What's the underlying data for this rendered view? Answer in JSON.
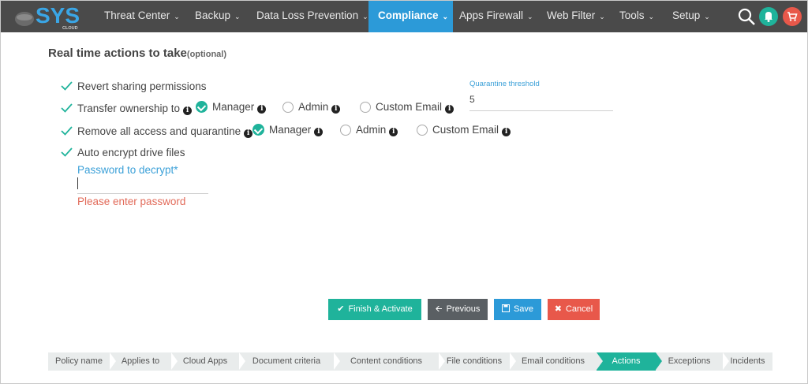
{
  "brand": {
    "logo_text": "SYS",
    "logo_sub": "CLOUD"
  },
  "nav": {
    "items": [
      {
        "label": "Threat Center"
      },
      {
        "label": "Backup"
      },
      {
        "label": "Data Loss Prevention"
      },
      {
        "label": "Compliance",
        "active": true
      },
      {
        "label": "Apps Firewall"
      },
      {
        "label": "Web Filter"
      },
      {
        "label": "Tools"
      },
      {
        "label": "Setup"
      }
    ],
    "icons": [
      "search-icon",
      "bell-icon",
      "cart-icon"
    ]
  },
  "colors": {
    "nav_bg": "#4a4a4a",
    "nav_active": "#2c9ad8",
    "green": "#1fb39b",
    "red": "#e8584a",
    "error": "#e26b5a"
  },
  "section": {
    "title": "Real time actions to take",
    "title_optional": "(optional)"
  },
  "actions": {
    "revert": {
      "label": "Revert sharing permissions",
      "checked": true
    },
    "transfer": {
      "label": "Transfer ownership to",
      "options": [
        {
          "label": "Manager",
          "selected": true
        },
        {
          "label": "Admin",
          "selected": false
        },
        {
          "label": "Custom Email",
          "selected": false
        }
      ]
    },
    "remove": {
      "label": "Remove all access and quarantine",
      "options": [
        {
          "label": "Manager",
          "selected": true
        },
        {
          "label": "Admin",
          "selected": false
        },
        {
          "label": "Custom Email",
          "selected": false
        }
      ]
    },
    "encrypt": {
      "label": "Auto encrypt drive files",
      "checked": true
    }
  },
  "quarantine": {
    "label": "Quarantine threshold",
    "value": "5"
  },
  "password": {
    "label": "Password to decrypt*",
    "value": "",
    "error": "Please enter password"
  },
  "buttons": {
    "finish": "Finish & Activate",
    "previous": "Previous",
    "save": "Save",
    "cancel": "Cancel"
  },
  "steps": [
    {
      "label": "Policy name"
    },
    {
      "label": "Applies to"
    },
    {
      "label": "Cloud Apps"
    },
    {
      "label": "Document criteria"
    },
    {
      "label": "Content conditions"
    },
    {
      "label": "File conditions"
    },
    {
      "label": "Email conditions"
    },
    {
      "label": "Actions",
      "active": true
    },
    {
      "label": "Exceptions"
    },
    {
      "label": "Incidents"
    }
  ]
}
